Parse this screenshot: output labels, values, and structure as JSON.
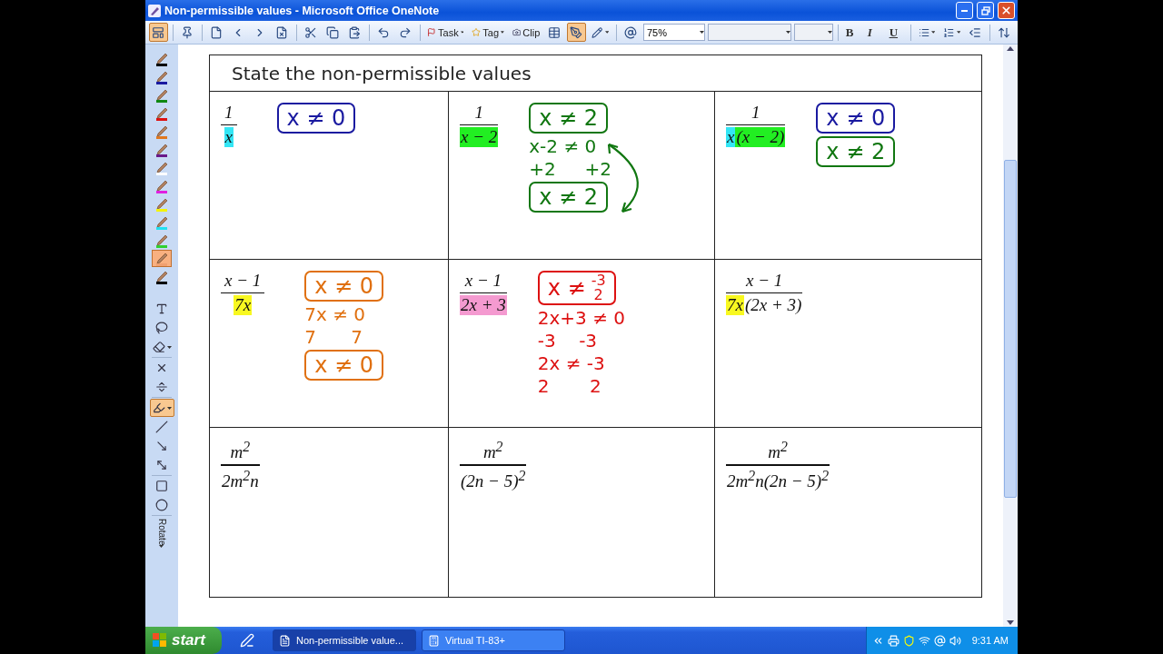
{
  "window": {
    "title": "Non-permissible values - Microsoft Office OneNote"
  },
  "toolbar": [
    {
      "kind": "icon",
      "pressed": true,
      "dropdown": false
    },
    {
      "kind": "separator"
    },
    {
      "kind": "icon",
      "pressed": false,
      "dropdown": false
    },
    {
      "kind": "separator"
    },
    {
      "kind": "icon",
      "pressed": false,
      "dropdown": false
    },
    {
      "kind": "icon",
      "pressed": false,
      "dropdown": false
    },
    {
      "kind": "icon",
      "pressed": false,
      "dropdown": false
    },
    {
      "kind": "icon",
      "pressed": false,
      "dropdown": false
    },
    {
      "kind": "separator"
    },
    {
      "kind": "icon",
      "pressed": false,
      "dropdown": false
    },
    {
      "kind": "icon",
      "pressed": false,
      "dropdown": false
    },
    {
      "kind": "icon",
      "pressed": false,
      "dropdown": false
    },
    {
      "kind": "separator"
    },
    {
      "kind": "icon",
      "pressed": false,
      "dropdown": false
    },
    {
      "kind": "icon",
      "pressed": false,
      "dropdown": false
    },
    {
      "kind": "separator"
    },
    {
      "kind": "labeled",
      "label": "Task",
      "dropdown": true
    },
    {
      "kind": "labeled",
      "label": "Tag",
      "dropdown": true
    },
    {
      "kind": "labeled",
      "label": "Clip",
      "dropdown": false
    },
    {
      "kind": "icon",
      "pressed": false,
      "dropdown": false
    },
    {
      "kind": "icon",
      "pressed": true,
      "dropdown": false
    },
    {
      "kind": "icon",
      "pressed": false,
      "dropdown": true
    },
    {
      "kind": "separator"
    },
    {
      "kind": "icon",
      "pressed": false,
      "dropdown": false
    },
    {
      "kind": "combo",
      "value": "75%"
    },
    {
      "kind": "fontbox"
    },
    {
      "kind": "sizebox"
    },
    {
      "kind": "separator"
    },
    {
      "kind": "text",
      "label": "B"
    },
    {
      "kind": "text",
      "label": "I"
    },
    {
      "kind": "text",
      "label": "U"
    },
    {
      "kind": "separator"
    },
    {
      "kind": "icon",
      "pressed": false,
      "dropdown": true
    },
    {
      "kind": "icon",
      "pressed": false,
      "dropdown": true
    },
    {
      "kind": "icon",
      "pressed": false,
      "dropdown": false
    },
    {
      "kind": "separator"
    },
    {
      "kind": "icon",
      "pressed": false,
      "dropdown": false
    }
  ],
  "pens": [
    {
      "color": "#000000",
      "selected": false
    },
    {
      "color": "#1a1aa0",
      "selected": false
    },
    {
      "color": "#118811",
      "selected": false
    },
    {
      "color": "#dd1111",
      "selected": false
    },
    {
      "color": "#e07820",
      "selected": false
    },
    {
      "color": "#6a1a8a",
      "selected": false
    },
    {
      "color": "#ffffff",
      "selected": false
    },
    {
      "color": "#e020e0",
      "selected": false
    },
    {
      "color": "#f4f40a",
      "selected": false
    },
    {
      "color": "#20e0f0",
      "selected": false
    },
    {
      "color": "#30d030",
      "selected": false
    },
    {
      "color": "#f0a070",
      "selected": true
    },
    {
      "color": "#000000",
      "selected": false
    }
  ],
  "tools": [
    {
      "kind": "icon",
      "pressed": false,
      "dropdown": false
    },
    {
      "kind": "icon",
      "pressed": false,
      "dropdown": false
    },
    {
      "kind": "icon",
      "pressed": false,
      "dropdown": true
    },
    {
      "kind": "separator"
    },
    {
      "kind": "icon",
      "pressed": false,
      "dropdown": false
    },
    {
      "kind": "icon",
      "pressed": false,
      "dropdown": false
    },
    {
      "kind": "separator"
    },
    {
      "kind": "icon",
      "pressed": true,
      "dropdown": true
    },
    {
      "kind": "icon",
      "pressed": false,
      "dropdown": false
    },
    {
      "kind": "icon",
      "pressed": false,
      "dropdown": false
    },
    {
      "kind": "icon",
      "pressed": false,
      "dropdown": false
    },
    {
      "kind": "separator"
    },
    {
      "kind": "icon",
      "pressed": false,
      "dropdown": false
    },
    {
      "kind": "icon",
      "pressed": false,
      "dropdown": false
    },
    {
      "kind": "separator"
    },
    {
      "kind": "labeled",
      "label": "Rotate",
      "dropdown": true
    }
  ],
  "page": {
    "title": "State the non-permissible values",
    "cells": [
      {
        "numerator": "1",
        "denominator": [
          {
            "text": "x",
            "color": "#33e6f5"
          }
        ],
        "notes": [
          {
            "kind": "box",
            "text": "x ≠ 0",
            "color": "#1a1aa0"
          }
        ]
      },
      {
        "numerator": "1",
        "denominator": [
          {
            "text": "x − 2",
            "color": "#22ee22"
          }
        ],
        "notes": [
          {
            "kind": "box",
            "text": "x ≠ 2",
            "color": "#117711"
          },
          {
            "kind": "text",
            "text": "x-2 ≠ 0",
            "color": "#117711"
          },
          {
            "kind": "text",
            "text": "+2     +2",
            "color": "#117711"
          },
          {
            "kind": "box",
            "text": "x ≠ 2",
            "color": "#117711"
          },
          {
            "kind": "arrow",
            "color": "#117711"
          }
        ]
      },
      {
        "numerator": "1",
        "denominator": [
          {
            "text": "x",
            "color": "#33e6f5"
          },
          {
            "text": "(x − 2)",
            "color": "#22ee22"
          }
        ],
        "notes": [
          {
            "kind": "box",
            "text": "x ≠ 0",
            "color": "#1a1aa0"
          },
          {
            "kind": "box",
            "text": "x ≠ 2",
            "color": "#117711"
          }
        ]
      },
      {
        "numerator": "x − 1",
        "denominator": [
          {
            "text": "7x",
            "color": "#f8f820"
          }
        ],
        "notes": [
          {
            "kind": "box",
            "text": "x ≠ 0",
            "color": "#e07010"
          },
          {
            "kind": "text",
            "text": "7x ≠ 0",
            "color": "#e07010"
          },
          {
            "kind": "text",
            "text": "7      7",
            "color": "#e07010"
          },
          {
            "kind": "box",
            "text": "x ≠ 0",
            "color": "#e07010"
          }
        ]
      },
      {
        "numerator": "x − 1",
        "denominator": [
          {
            "text": "2x + 3",
            "color": "#f49ad0"
          }
        ],
        "notes": [
          {
            "kind": "fracbox",
            "text": "x ≠",
            "numerator": "-3",
            "denominator": "2",
            "color": "#dd1111"
          },
          {
            "kind": "text",
            "text": "2x+3 ≠ 0",
            "color": "#dd1111"
          },
          {
            "kind": "text",
            "text": "-3    -3",
            "color": "#dd1111"
          },
          {
            "kind": "text",
            "text": "2x ≠ -3",
            "color": "#dd1111"
          },
          {
            "kind": "text",
            "text": "2       2",
            "color": "#dd1111"
          }
        ]
      },
      {
        "numerator": "x − 1",
        "denominator": [
          {
            "text": "7x",
            "color": "#f8f820"
          },
          {
            "text": "(2x + 3)"
          }
        ]
      },
      {
        "numerator": "m$^{2}$",
        "denominator": [
          {
            "text": "2m$^{2}$n"
          }
        ]
      },
      {
        "numerator": "m$^{2}$",
        "denominator": [
          {
            "text": "(2n − 5)$^{2}$"
          }
        ]
      },
      {
        "numerator": "m$^{2}$",
        "denominator": [
          {
            "text": "2m$^{2}$n(2n − 5)$^{2}$"
          }
        ]
      }
    ]
  },
  "taskbar": {
    "start": "start",
    "tasks": [
      {
        "label": "Non-permissible value...",
        "selected": true
      },
      {
        "label": "Virtual TI-83+",
        "selected": false
      }
    ],
    "clock": "9:31 AM"
  }
}
